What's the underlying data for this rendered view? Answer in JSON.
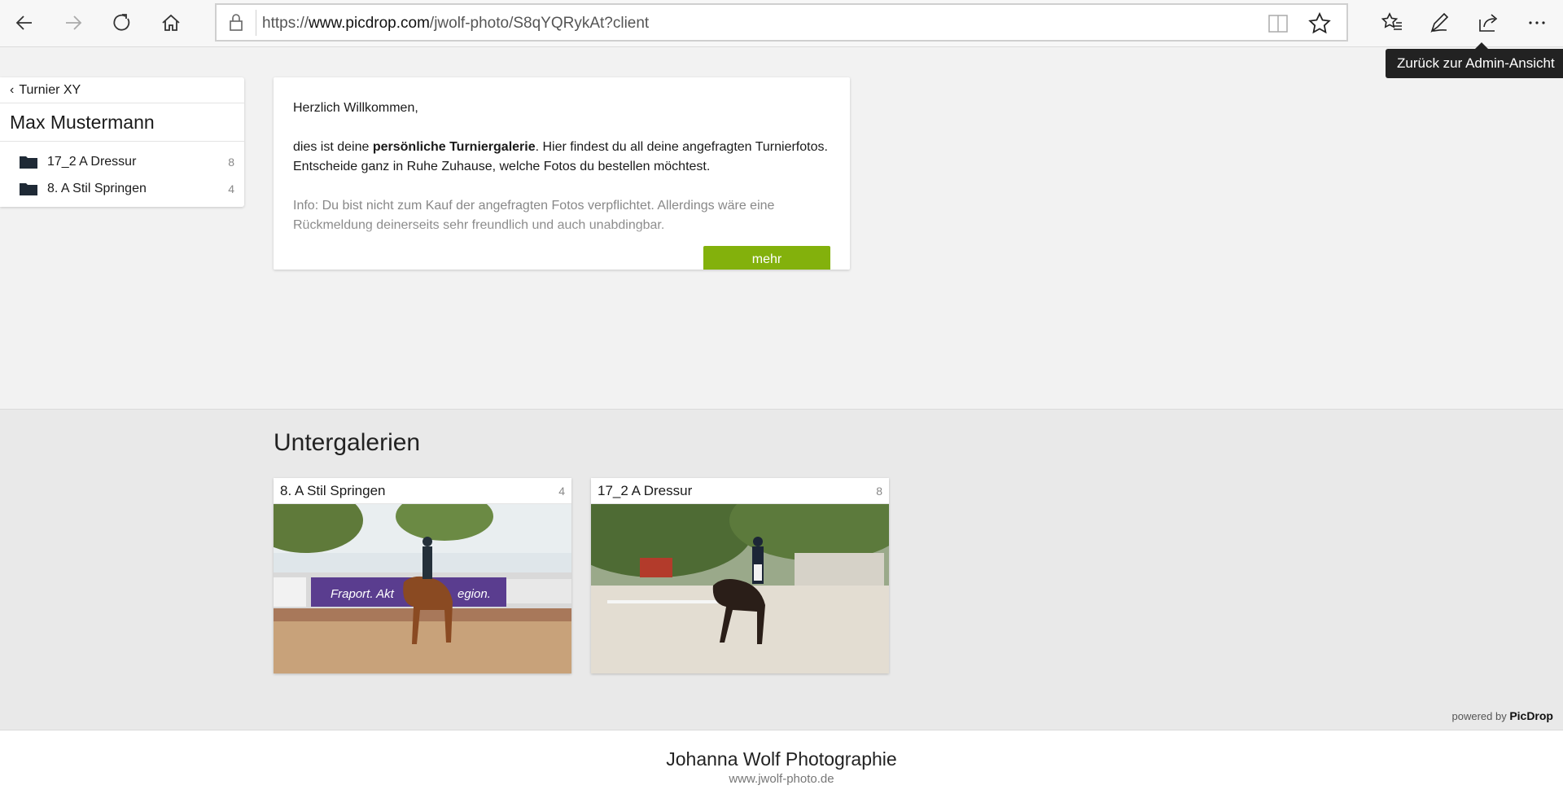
{
  "browser": {
    "url_prefix": "https://",
    "url_host": "www.picdrop.com",
    "url_path": "/jwolf-photo/S8qYQRykAt?client",
    "icons": [
      "back-icon",
      "forward-icon",
      "refresh-icon",
      "home-icon",
      "lock-icon",
      "reading-view-icon",
      "favorite-star-icon",
      "favorites-list-icon",
      "pen-icon",
      "share-icon",
      "more-icon"
    ]
  },
  "tooltip": {
    "text": "Zurück zur Admin-Ansicht"
  },
  "sidebar": {
    "back_label": "Turnier XY",
    "title": "Max Mustermann",
    "items": [
      {
        "label": "17_2 A Dressur",
        "count": "8"
      },
      {
        "label": "8. A Stil Springen",
        "count": "4"
      }
    ]
  },
  "welcome": {
    "greeting": "Herzlich Willkommen,",
    "p1_before": "dies ist deine ",
    "p1_bold": "persönliche Turniergalerie",
    "p1_after": ". Hier findest du all deine angefragten Turnierfotos. Entscheide ganz in Ruhe Zuhause, welche Fotos du bestellen möchtest.",
    "info": "Info: Du bist nicht zum Kauf der angefragten Fotos verpflichtet. Allerdings wäre eine Rückmeldung deinerseits sehr freundlich und auch unabdingbar.",
    "more_label": "mehr"
  },
  "subgalleries": {
    "heading": "Untergalerien",
    "tiles": [
      {
        "label": "8. A Stil Springen",
        "count": "4",
        "banner_text": "Fraport. Akt",
        "banner_text2": "egion."
      },
      {
        "label": "17_2 A Dressur",
        "count": "8"
      }
    ],
    "powered_prefix": "powered by ",
    "powered_brand": "PicDrop"
  },
  "footer": {
    "name": "Johanna Wolf Photographie",
    "site": "www.jwolf-photo.de"
  },
  "colors": {
    "accent": "#83b10c",
    "tooltip_bg": "#222222"
  }
}
